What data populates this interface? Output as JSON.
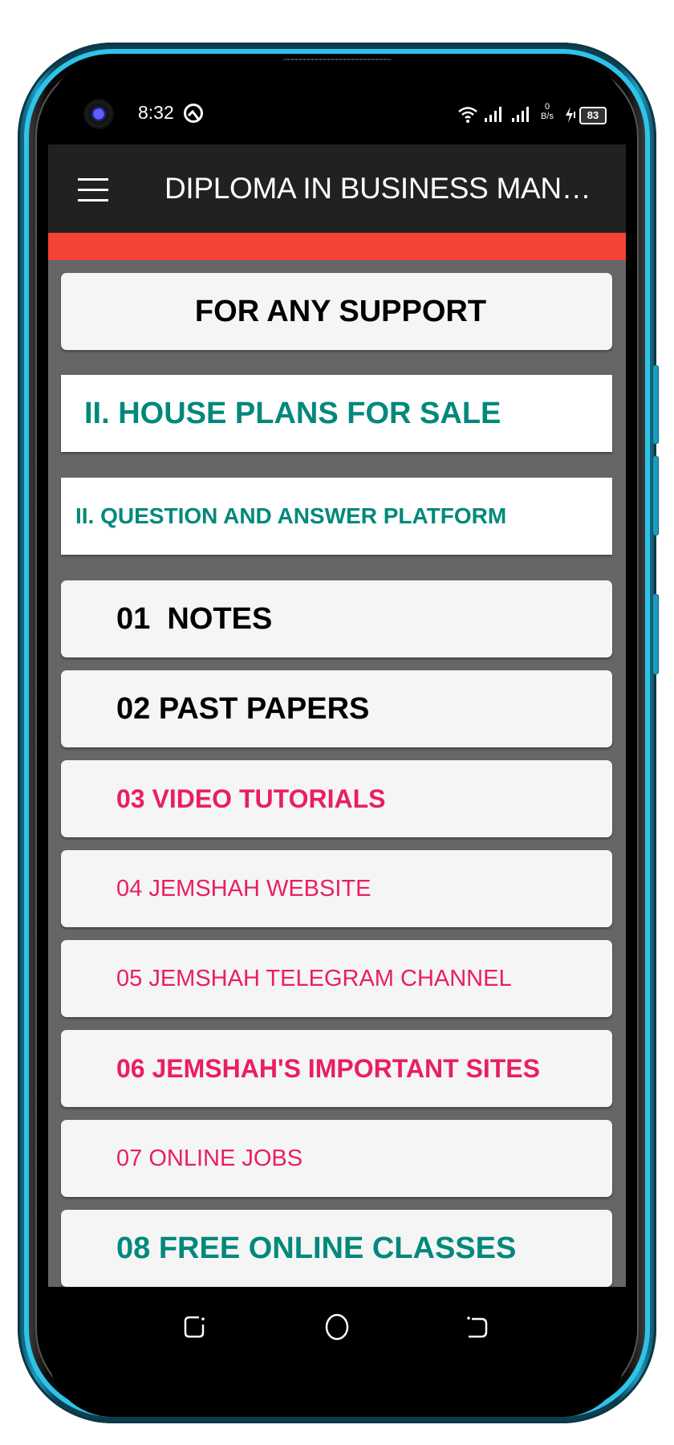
{
  "status_bar": {
    "time": "8:32",
    "net_speed_value": "0",
    "net_speed_unit": "B/s",
    "battery_level": "83",
    "icons": [
      "front-camera",
      "q-notification-icon",
      "wifi-icon",
      "signal-icon",
      "signal-icon",
      "charging-icon",
      "battery-icon"
    ]
  },
  "app_bar": {
    "menu_icon": "hamburger-menu-icon",
    "title": "DIPLOMA IN BUSINESS MANAGEMENT"
  },
  "colors": {
    "app_bar": "#212121",
    "accent_bar": "#f44336",
    "background": "#666666",
    "teal": "#00897b",
    "pink": "#e91e63",
    "black": "#000000"
  },
  "menu": [
    {
      "label": "FOR ANY SUPPORT",
      "color": "#000000"
    },
    {
      "label": "II. HOUSE PLANS FOR SALE",
      "color": "#00897b"
    },
    {
      "label": "II. QUESTION AND ANSWER PLATFORM",
      "color": "#00897b"
    },
    {
      "label": "01  NOTES",
      "color": "#000000"
    },
    {
      "label": "02 PAST PAPERS",
      "color": "#000000"
    },
    {
      "label": "03 VIDEO TUTORIALS",
      "color": "#e91e63"
    },
    {
      "label": "04 JEMSHAH WEBSITE",
      "color": "#e91e63"
    },
    {
      "label": "05 JEMSHAH TELEGRAM CHANNEL",
      "color": "#e91e63"
    },
    {
      "label": "06 JEMSHAH'S IMPORTANT SITES",
      "color": "#e91e63"
    },
    {
      "label": "07 ONLINE JOBS",
      "color": "#e91e63"
    },
    {
      "label": "08 FREE ONLINE CLASSES",
      "color": "#00897b"
    }
  ],
  "nav_bar": {
    "buttons": [
      "recent-apps",
      "home",
      "back"
    ]
  }
}
